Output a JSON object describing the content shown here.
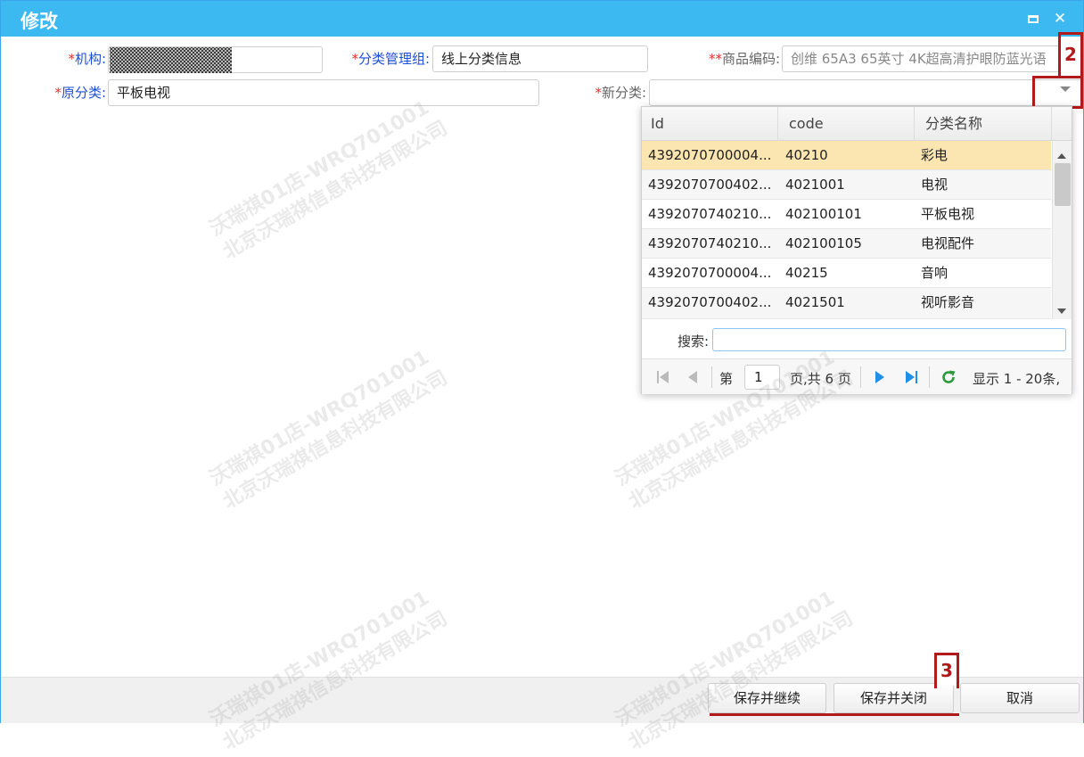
{
  "window": {
    "title": "修改"
  },
  "form": {
    "org": {
      "label": "机构:",
      "required_mark": "*"
    },
    "group": {
      "label": "分类管理组:",
      "required_mark": "*",
      "value": "线上分类信息"
    },
    "product_code": {
      "label": "商品编码:",
      "required_mark": "**",
      "value": "创维 65A3 65英寸 4K超高清护眼防蓝光语"
    },
    "original_category": {
      "label": "原分类:",
      "required_mark": "*",
      "value": "平板电视"
    },
    "new_category": {
      "label": "新分类:",
      "required_mark": "*",
      "value": ""
    }
  },
  "dropdown": {
    "columns": [
      "Id",
      "code",
      "分类名称"
    ],
    "rows": [
      {
        "id": "4392070700004...",
        "code": "40210",
        "name": "彩电"
      },
      {
        "id": "4392070700402...",
        "code": "4021001",
        "name": "电视"
      },
      {
        "id": "4392070740210...",
        "code": "402100101",
        "name": "平板电视"
      },
      {
        "id": "4392070740210...",
        "code": "402100105",
        "name": "电视配件"
      },
      {
        "id": "4392070700004...",
        "code": "40215",
        "name": "音响"
      },
      {
        "id": "4392070700402...",
        "code": "4021501",
        "name": "视听影音"
      }
    ],
    "search_label": "搜索:",
    "search_value": "",
    "pager": {
      "page_prefix": "第",
      "page_value": "1",
      "page_suffix": "页,共 6 页",
      "display_text": "显示 1 - 20条,"
    }
  },
  "annotations": {
    "marker_2": "2",
    "marker_3": "3"
  },
  "footer": {
    "save_continue": "保存并继续",
    "save_close": "保存并关闭",
    "cancel": "取消"
  },
  "watermark": {
    "line1": "沃瑞祺01店-WRQ701001",
    "line2": "北京沃瑞祺信息科技有限公司"
  },
  "colors": {
    "titlebar": "#3db9f2",
    "label_blue": "#1f4ed8",
    "required_red": "#e0302a",
    "selected_row": "#fbe6b2",
    "annotation_red": "#b01a1a",
    "pager_blue": "#1e90e8",
    "refresh_green": "#2a9a3a"
  }
}
